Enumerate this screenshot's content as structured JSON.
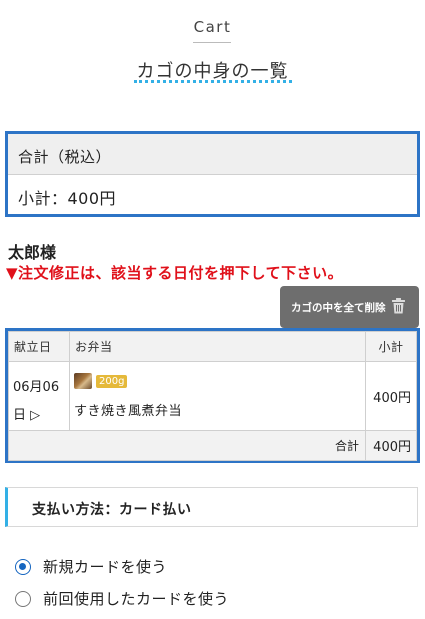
{
  "header": {
    "title_en": "Cart",
    "title_jp": "カゴの中身の一覧"
  },
  "total_box": {
    "label": "合計（税込）",
    "subtotal_text": "小計：400円"
  },
  "customer_name": "太郎様",
  "notice": "▼注文修正は、該当する日付を押下して下さい。",
  "clear_cart_button": {
    "label": "カゴの中を全て削除",
    "icon": "trash-icon"
  },
  "cart_table": {
    "headers": [
      "献立日",
      "お弁当",
      "小計"
    ],
    "rows": [
      {
        "date": "06月06",
        "date_suffix": "日 ▷",
        "weight_badge": "200g",
        "name": "すき焼き風煮弁当",
        "subtotal": "400円"
      }
    ],
    "total_label": "合計",
    "total_value": "400円"
  },
  "payment": {
    "heading": "支払い方法：カード払い",
    "options": [
      {
        "label": "新規カードを使う",
        "selected": true
      },
      {
        "label": "前回使用したカードを使う",
        "selected": false
      }
    ]
  },
  "colors": {
    "accent_blue": "#2d74c6",
    "dot_blue": "#33b0e6",
    "notice_red": "#e0101a",
    "badge_yellow": "#e5b93a"
  }
}
